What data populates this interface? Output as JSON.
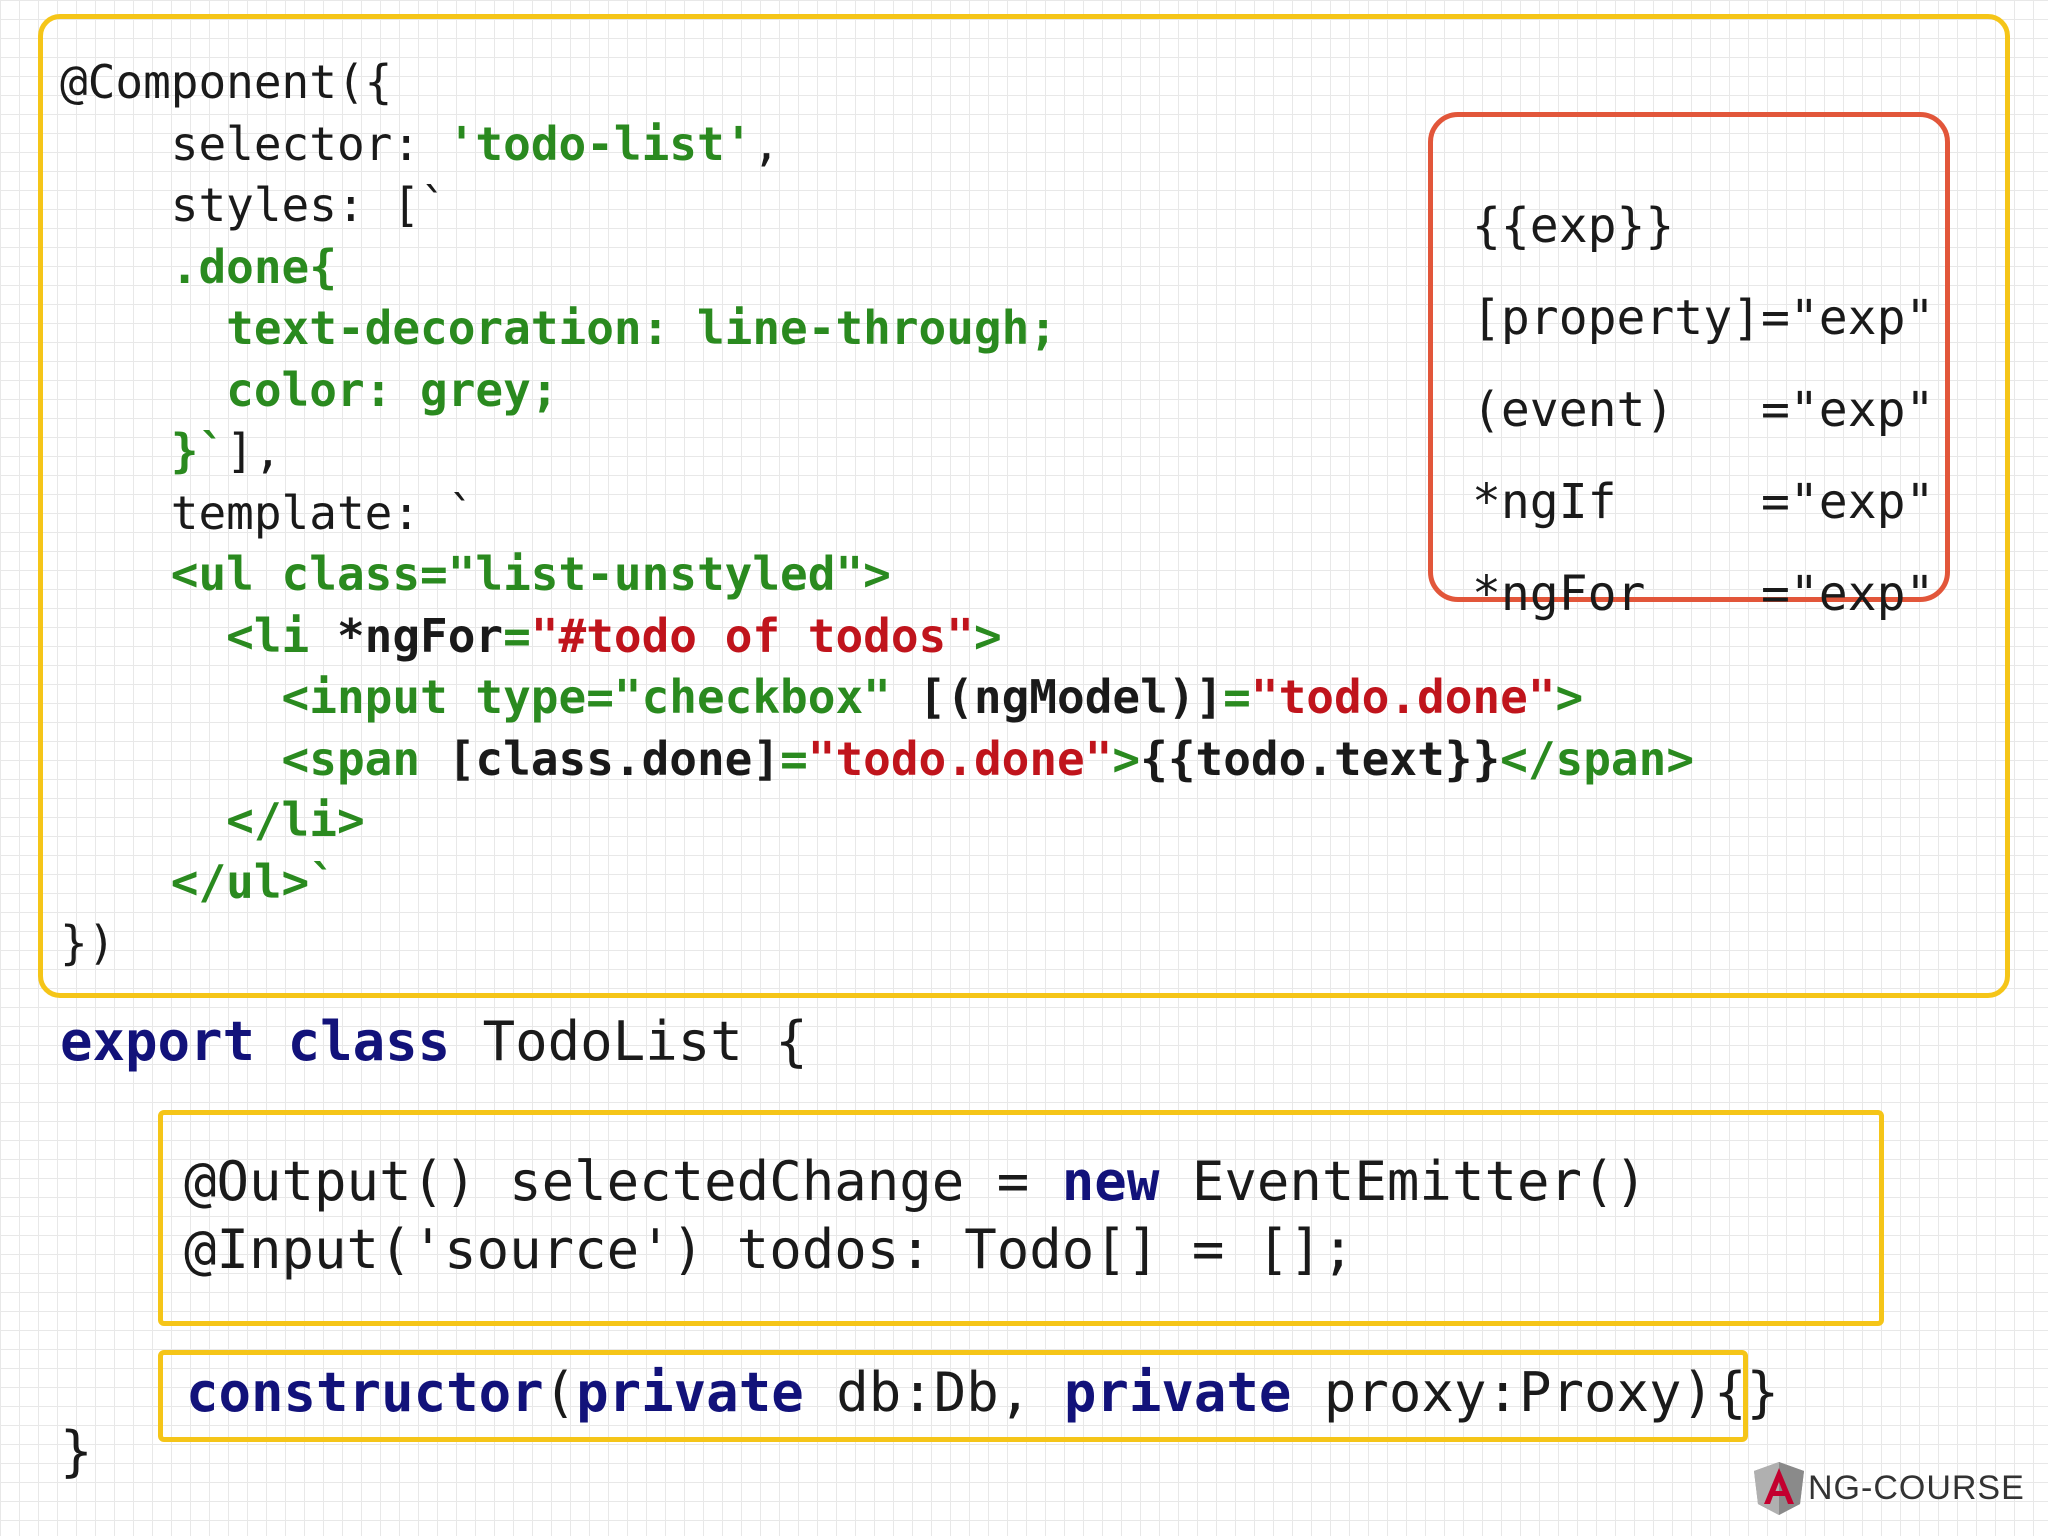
{
  "component_block": {
    "lines": [
      [
        {
          "t": "@Component({",
          "c": ""
        }
      ],
      [
        {
          "t": "    selector: ",
          "c": ""
        },
        {
          "t": "'todo-list'",
          "c": "kw-green"
        },
        {
          "t": ",",
          "c": ""
        }
      ],
      [
        {
          "t": "    styles: [`",
          "c": ""
        }
      ],
      [
        {
          "t": "    .done{",
          "c": "kw-green"
        }
      ],
      [
        {
          "t": "      text-decoration: line-through;",
          "c": "kw-green"
        }
      ],
      [
        {
          "t": "      color: grey;",
          "c": "kw-green"
        }
      ],
      [
        {
          "t": "    }`",
          "c": "kw-green"
        },
        {
          "t": "],",
          "c": ""
        }
      ],
      [
        {
          "t": "    template: `",
          "c": ""
        }
      ],
      [
        {
          "t": "    <ul class=\"list-unstyled\">",
          "c": "kw-green"
        }
      ],
      [
        {
          "t": "      <li ",
          "c": "kw-green"
        },
        {
          "t": "*ngFor",
          "c": "blk-b"
        },
        {
          "t": "=",
          "c": "kw-green"
        },
        {
          "t": "\"#todo of todos\"",
          "c": "str-red"
        },
        {
          "t": ">",
          "c": "kw-green"
        }
      ],
      [
        {
          "t": "        <input type=\"checkbox\" ",
          "c": "kw-green"
        },
        {
          "t": "[(ngModel)]",
          "c": "blk-b"
        },
        {
          "t": "=",
          "c": "kw-green"
        },
        {
          "t": "\"todo.done\"",
          "c": "str-red"
        },
        {
          "t": ">",
          "c": "kw-green"
        }
      ],
      [
        {
          "t": "        <span ",
          "c": "kw-green"
        },
        {
          "t": "[class.done]",
          "c": "blk-b"
        },
        {
          "t": "=",
          "c": "kw-green"
        },
        {
          "t": "\"todo.done\"",
          "c": "str-red"
        },
        {
          "t": ">",
          "c": "kw-green"
        },
        {
          "t": "{{todo.text}}",
          "c": "blk-b"
        },
        {
          "t": "</span>",
          "c": "kw-green"
        }
      ],
      [
        {
          "t": "      </li>",
          "c": "kw-green"
        }
      ],
      [
        {
          "t": "    </ul>`",
          "c": "kw-green"
        }
      ],
      [
        {
          "t": "})",
          "c": ""
        }
      ]
    ]
  },
  "bindings_box": {
    "items": [
      {
        "syntax": "{{exp}}",
        "value": ""
      },
      {
        "syntax": "[property]",
        "value": "=\"exp\""
      },
      {
        "syntax": "(event)",
        "value": "=\"exp\""
      },
      {
        "syntax": "*ngIf",
        "value": "=\"exp\""
      },
      {
        "syntax": "*ngFor",
        "value": "=\"exp\""
      }
    ]
  },
  "class_decl": {
    "keyword": "export class",
    "name": " TodoList {"
  },
  "io_block": {
    "line1_pre": "@Output() selectedChange = ",
    "line1_kw": "new",
    "line1_post": " EventEmitter()",
    "line2": "@Input('source') todos: Todo[] = [];"
  },
  "ctor_block": {
    "kw1": "constructor",
    "p1": "(",
    "kw2": "private",
    "p2": " db:Db, ",
    "kw3": "private",
    "p3": " proxy:Proxy){}"
  },
  "closing_brace": "}",
  "logo": {
    "text": "NG-COURSE",
    "accent": "#c3002f"
  }
}
